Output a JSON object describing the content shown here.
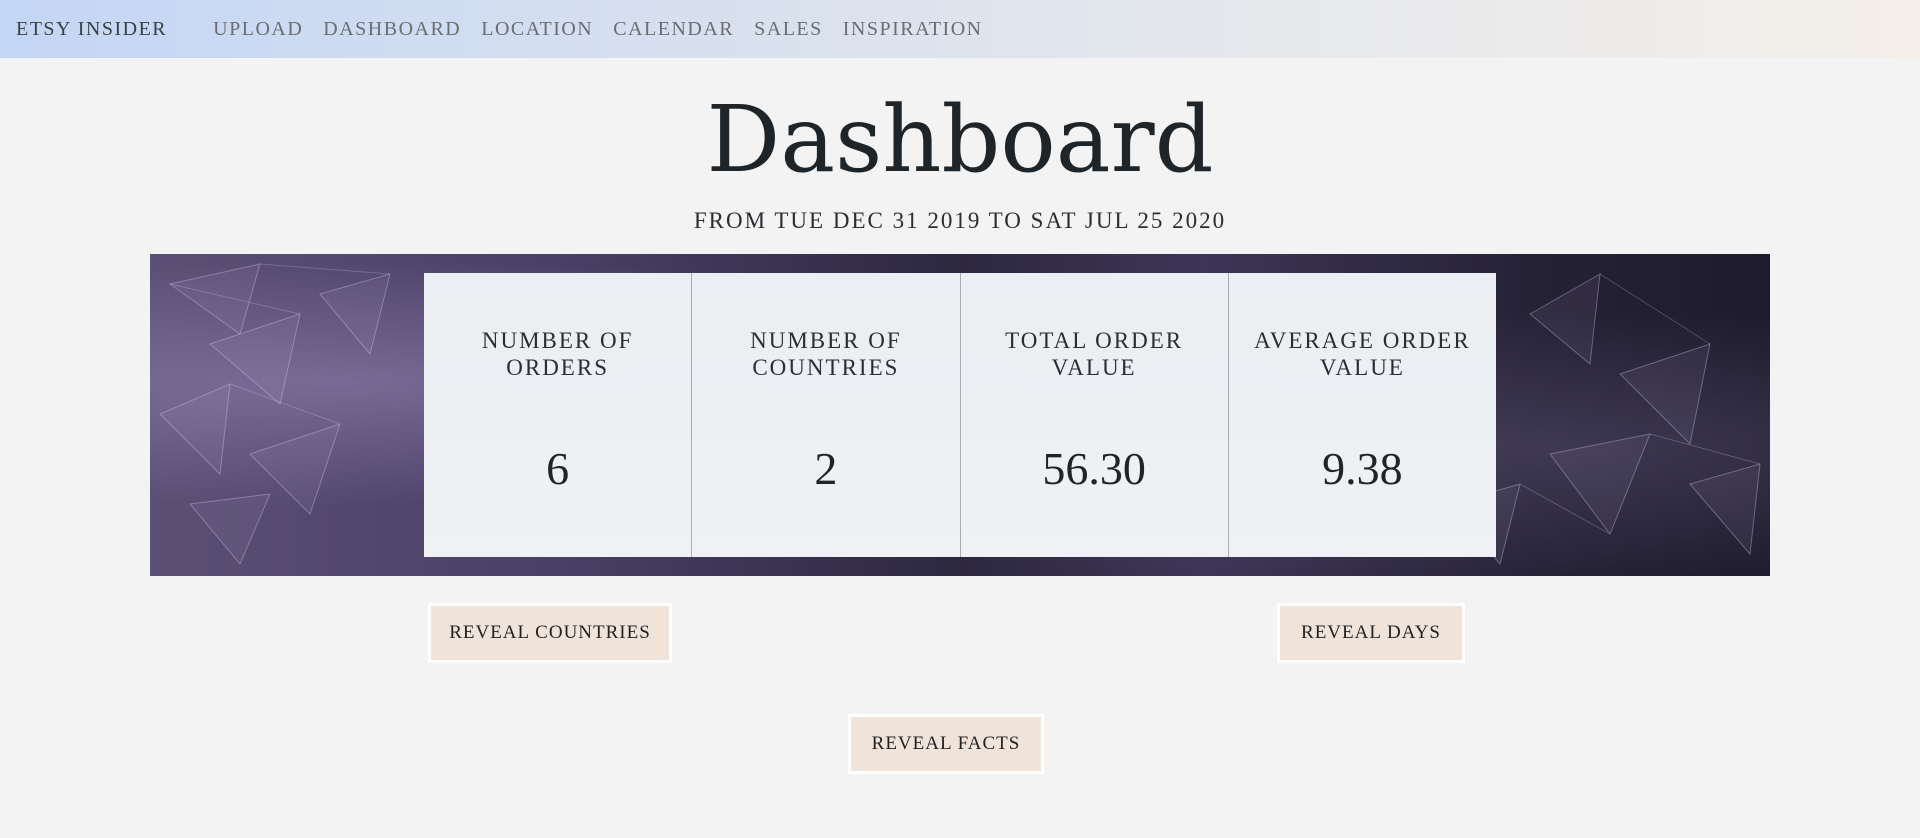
{
  "nav": {
    "brand": "ETSY INSIDER",
    "links": [
      "UPLOAD",
      "DASHBOARD",
      "LOCATION",
      "CALENDAR",
      "SALES",
      "INSPIRATION"
    ]
  },
  "page": {
    "title": "Dashboard",
    "date_range": "FROM TUE DEC 31 2019 TO SAT JUL 25 2020"
  },
  "stats": [
    {
      "label": "NUMBER OF ORDERS",
      "value": "6"
    },
    {
      "label": "NUMBER OF COUNTRIES",
      "value": "2"
    },
    {
      "label": "TOTAL ORDER VALUE",
      "value": "56.30"
    },
    {
      "label": "AVERAGE ORDER VALUE",
      "value": "9.38"
    }
  ],
  "buttons": {
    "reveal_countries": "REVEAL COUNTRIES",
    "reveal_days": "REVEAL DAYS",
    "reveal_facts": "REVEAL FACTS"
  },
  "colors": {
    "background": "#f3f3f3",
    "button_bg": "#efe3da",
    "banner_dark": "#2d2840"
  }
}
